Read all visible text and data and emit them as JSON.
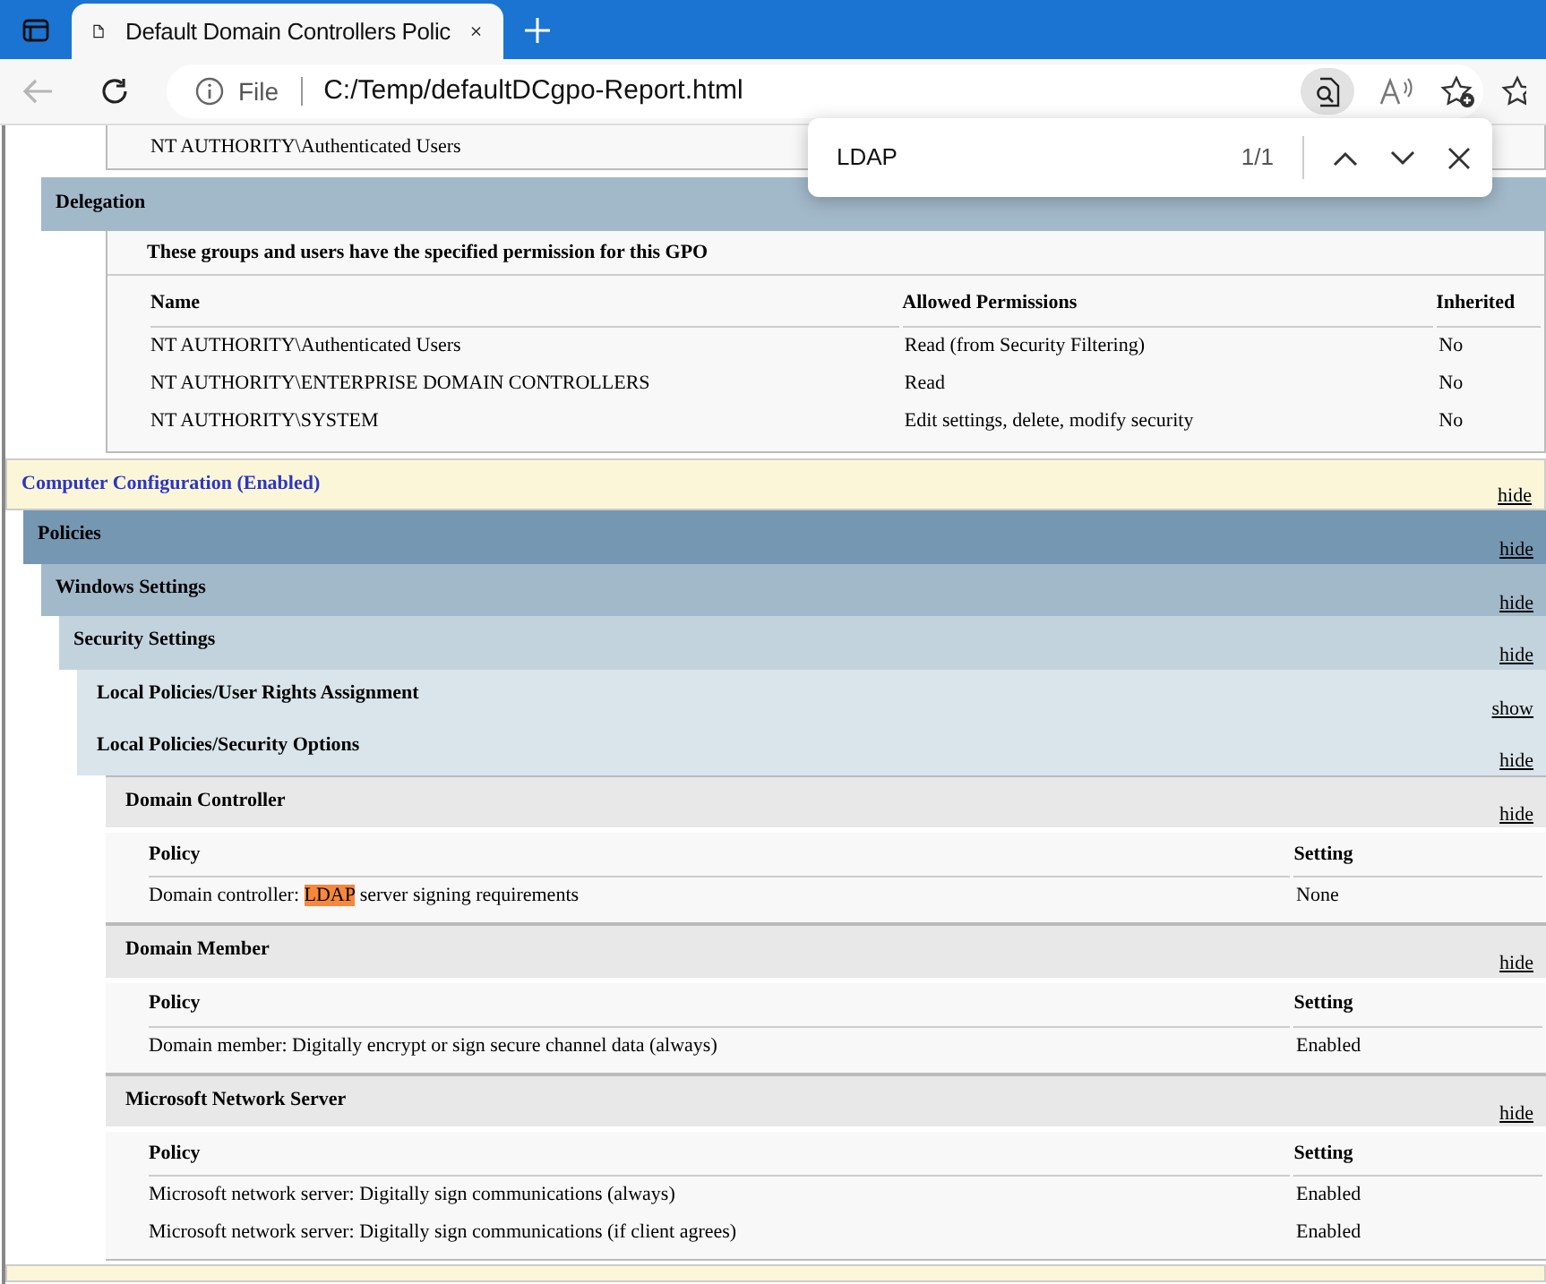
{
  "browser": {
    "tab_title": "Default Domain Controllers Polic",
    "address_label": "File",
    "url": "C:/Temp/defaultDCgpo-Report.html"
  },
  "find_bar": {
    "query": "LDAP",
    "count": "1/1"
  },
  "top_fragment": "NT AUTHORITY\\Authenticated Users",
  "delegation": {
    "title": "Delegation",
    "caption": "These groups and users have the specified permission for this GPO",
    "columns": [
      "Name",
      "Allowed Permissions",
      "Inherited"
    ],
    "rows": [
      [
        "NT AUTHORITY\\Authenticated Users",
        "Read (from Security Filtering)",
        "No"
      ],
      [
        "NT AUTHORITY\\ENTERPRISE DOMAIN CONTROLLERS",
        "Read",
        "No"
      ],
      [
        "NT AUTHORITY\\SYSTEM",
        "Edit settings, delete, modify security",
        "No"
      ]
    ]
  },
  "sections": [
    {
      "title": "Computer Configuration (Enabled)",
      "toggle": "hide",
      "children": [
        {
          "title": "Policies",
          "toggle": "hide",
          "children": [
            {
              "title": "Windows Settings",
              "toggle": "hide",
              "children": [
                {
                  "title": "Security Settings",
                  "toggle": "hide",
                  "children": [
                    {
                      "title": "Local Policies/User Rights Assignment",
                      "toggle": "show"
                    },
                    {
                      "title": "Local Policies/Security Options",
                      "toggle": "hide",
                      "children": [
                        {
                          "title": "Domain Controller",
                          "toggle": "hide",
                          "table": {
                            "columns": [
                              "Policy",
                              "Setting"
                            ],
                            "rows": [
                              {
                                "policy": [
                                  {
                                    "text": "Domain controller: ",
                                    "highlighted": false
                                  },
                                  {
                                    "text": "LDAP",
                                    "highlighted": true
                                  },
                                  {
                                    "text": " server signing requirements",
                                    "highlighted": false
                                  }
                                ],
                                "setting": "None"
                              }
                            ]
                          }
                        },
                        {
                          "title": "Domain Member",
                          "toggle": "hide",
                          "table": {
                            "columns": [
                              "Policy",
                              "Setting"
                            ],
                            "rows": [
                              {
                                "policy": [
                                  {
                                    "text": "Domain member: Digitally encrypt or sign secure channel data (always)",
                                    "highlighted": false
                                  }
                                ],
                                "setting": "Enabled"
                              }
                            ]
                          }
                        },
                        {
                          "title": "Microsoft Network Server",
                          "toggle": "hide",
                          "table": {
                            "columns": [
                              "Policy",
                              "Setting"
                            ],
                            "rows": [
                              {
                                "policy": [
                                  {
                                    "text": "Microsoft network server: Digitally sign communications (always)",
                                    "highlighted": false
                                  }
                                ],
                                "setting": "Enabled"
                              },
                              {
                                "policy": [
                                  {
                                    "text": "Microsoft network server: Digitally sign communications (if client agrees)",
                                    "highlighted": false
                                  }
                                ],
                                "setting": "Enabled"
                              }
                            ]
                          }
                        }
                      ]
                    }
                  ]
                }
              ]
            }
          ]
        }
      ]
    }
  ]
}
